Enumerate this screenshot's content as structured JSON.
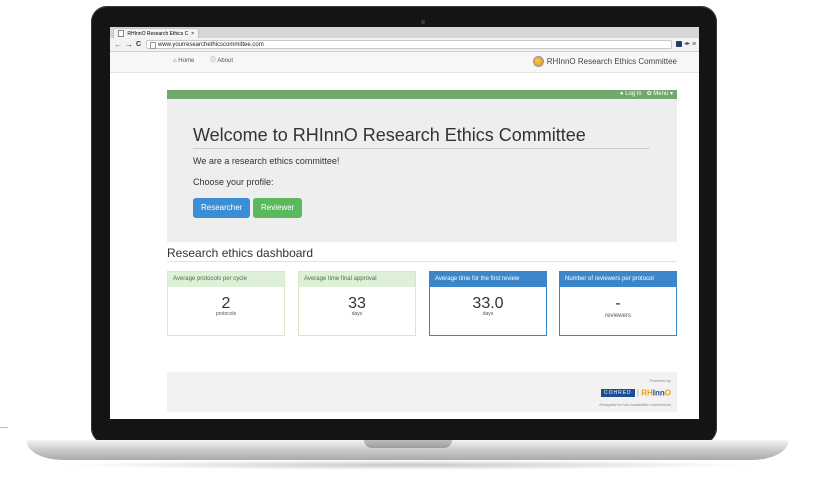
{
  "browser": {
    "tab_title": "RHInnO Research Ethics C",
    "tab_close": "×",
    "back": "←",
    "forward": "→",
    "reload": "C",
    "url": "www.yourresearchethicscommittee.com",
    "menu_glyph": "≡"
  },
  "nav": {
    "home_label": "Home",
    "about_label": "About",
    "brand_label": "RHInnO Research Ethics Committee"
  },
  "topbar": {
    "login_label": "Log in",
    "menu_label": "Menu"
  },
  "jumbotron": {
    "title": "Welcome to RHInnO Research Ethics Committee",
    "subtitle": "We are a research ethics committee!",
    "choose_profile": "Choose your profile:",
    "researcher_button": "Researcher",
    "reviewer_button": "Reviewer"
  },
  "dashboard": {
    "title": "Research ethics dashboard",
    "cards": [
      {
        "header": "Average protocols per cycle",
        "value": "2",
        "unit": "protocols",
        "style": "green"
      },
      {
        "header": "Average time final approval",
        "value": "33",
        "unit": "days",
        "style": "green"
      },
      {
        "header": "Average time for the first review",
        "value": "33.0",
        "unit": "days",
        "style": "blue"
      },
      {
        "header": "Number of reviewers per protocol",
        "value": "-",
        "unit": "reviewers",
        "style": "blue"
      }
    ]
  },
  "footer": {
    "powered_by": "Powered by",
    "cohred_label": "COHRED",
    "separator": "|",
    "rhinno_prefix": "RH",
    "rhinno_suffix": "Inn",
    "rhinno_end": "O",
    "tagline": "Designed for low bandwidth connections"
  },
  "colors": {
    "green_bar": "#6fa96d",
    "researcher_button": "#3b8ed4",
    "reviewer_button": "#5cb85c",
    "card_blue": "#3b87c9",
    "card_green_header": "#dff0d8"
  }
}
